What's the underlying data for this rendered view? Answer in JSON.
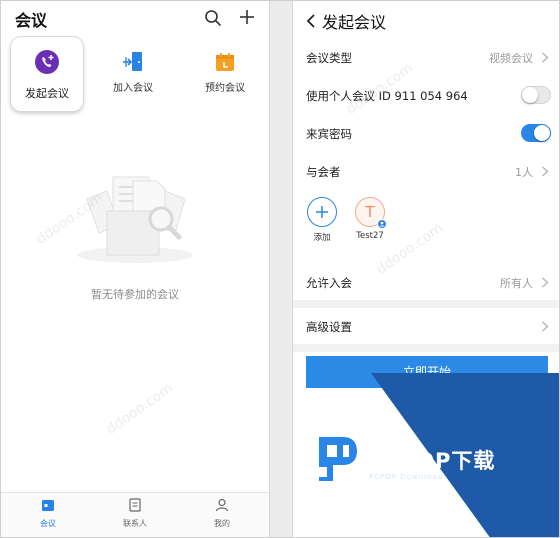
{
  "left": {
    "title": "会议",
    "quick_actions": [
      {
        "label": "发起会议",
        "icon": "phone-plus-icon",
        "color": "#6b2fb5",
        "selected": true
      },
      {
        "label": "加入会议",
        "icon": "join-door-icon",
        "color": "#2a82e4",
        "selected": false
      },
      {
        "label": "预约会议",
        "icon": "calendar-icon",
        "color": "#f5a023",
        "selected": false
      }
    ],
    "empty_text": "暂无待参加的会议",
    "tabs": [
      {
        "label": "会议",
        "icon": "calendar-tab-icon",
        "active": true
      },
      {
        "label": "联系人",
        "icon": "contacts-icon",
        "active": false
      },
      {
        "label": "我的",
        "icon": "person-icon",
        "active": false
      }
    ]
  },
  "right": {
    "title": "发起会议",
    "rows": {
      "type": {
        "label": "会议类型",
        "value": "视频会议"
      },
      "personal_id": {
        "label": "使用个人会议 ID 911 054 964",
        "toggle": false
      },
      "password": {
        "label": "来宾密码",
        "toggle": true
      },
      "participants": {
        "label": "与会者",
        "value": "1人"
      },
      "allow": {
        "label": "允许入会",
        "value": "所有人"
      },
      "advanced": {
        "label": "高级设置"
      }
    },
    "add_label": "添加",
    "participant_name": "Test27",
    "participant_initial": "T",
    "start_button": "立即开始"
  },
  "watermark": {
    "brand": "PCPOP下载",
    "brand_sub": "PCPOP Download",
    "site": "ddooo.com",
    "colors": {
      "band": "#1e5aa8",
      "accent": "#2a86e6"
    }
  }
}
